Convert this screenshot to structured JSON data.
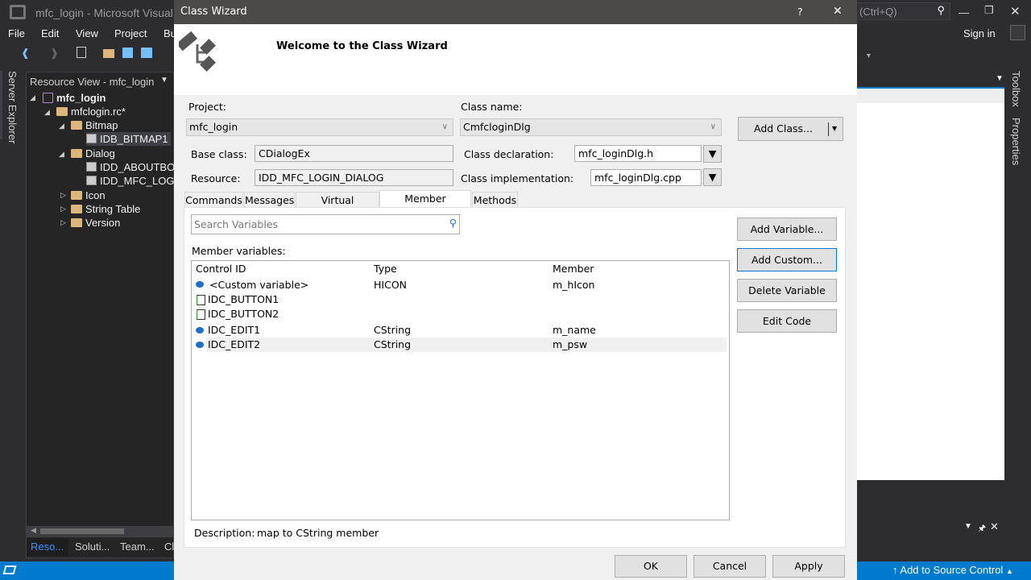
{
  "ide": {
    "title": "mfc_login - Microsoft Visual S",
    "quick_launch_hint": "(Ctrl+Q)",
    "sign_in": "Sign in",
    "menu": [
      "File",
      "Edit",
      "View",
      "Project",
      "Bu"
    ],
    "left_vertical_tab": "Server Explorer",
    "right_vertical_tabs": [
      "Toolbox",
      "Properties"
    ],
    "resource_view": {
      "title": "Resource View - mfc_login",
      "tree": [
        {
          "label": "mfc_login",
          "kind": "project",
          "expanded": true
        },
        {
          "label": "mfclogin.rc*",
          "kind": "folder",
          "expanded": true
        },
        {
          "label": "Bitmap",
          "kind": "folder",
          "expanded": true
        },
        {
          "label": "IDB_BITMAP1",
          "kind": "resource",
          "selected": true
        },
        {
          "label": "Dialog",
          "kind": "folder",
          "expanded": true
        },
        {
          "label": "IDD_ABOUTBOX",
          "kind": "resource"
        },
        {
          "label": "IDD_MFC_LOGIN",
          "kind": "resource"
        },
        {
          "label": "Icon",
          "kind": "folder",
          "expanded": false
        },
        {
          "label": "String Table",
          "kind": "folder",
          "expanded": false
        },
        {
          "label": "Version",
          "kind": "folder",
          "expanded": false
        }
      ],
      "bottom_tabs": [
        "Reso...",
        "Soluti...",
        "Team...",
        "Cl"
      ]
    },
    "status_bar": {
      "right": "Add to Source Control",
      "color": "#007acc"
    }
  },
  "dialog": {
    "title": "Class Wizard",
    "help": "?",
    "close": "✕",
    "heading": "Welcome to the Class Wizard",
    "project_label": "Project:",
    "project_value": "mfc_login",
    "class_name_label": "Class name:",
    "class_name_value": "CmfcloginDlg",
    "add_class": "Add Class...",
    "base_class_label": "Base class:",
    "base_class_value": "CDialogEx",
    "resource_label": "Resource:",
    "resource_value": "IDD_MFC_LOGIN_DIALOG",
    "class_decl_label": "Class declaration:",
    "class_decl_value": "mfc_loginDlg.h",
    "class_impl_label": "Class implementation:",
    "class_impl_value": "mfc_loginDlg.cpp",
    "tabs": [
      "Commands",
      "Messages",
      "Virtual Functions",
      "Member Variables",
      "Methods"
    ],
    "active_tab": "Member Variables",
    "search_placeholder": "Search Variables",
    "member_vars_label": "Member variables:",
    "columns": [
      "Control ID",
      "Type",
      "Member"
    ],
    "rows": [
      {
        "id": "<Custom variable>",
        "type": "HICON",
        "member": "m_hIcon",
        "icon": "custom-variable"
      },
      {
        "id": "IDC_BUTTON1",
        "type": "",
        "member": "",
        "icon": "button-control"
      },
      {
        "id": "IDC_BUTTON2",
        "type": "",
        "member": "",
        "icon": "button-control"
      },
      {
        "id": "IDC_EDIT1",
        "type": "CString",
        "member": "m_name",
        "icon": "variable"
      },
      {
        "id": "IDC_EDIT2",
        "type": "CString",
        "member": "m_psw",
        "icon": "variable",
        "selected": true
      }
    ],
    "side_buttons": [
      "Add Variable...",
      "Add Custom...",
      "Delete Variable",
      "Edit Code"
    ],
    "description_label": "Description:",
    "description_value": "map to CString member",
    "ok": "OK",
    "cancel": "Cancel",
    "apply": "Apply"
  }
}
